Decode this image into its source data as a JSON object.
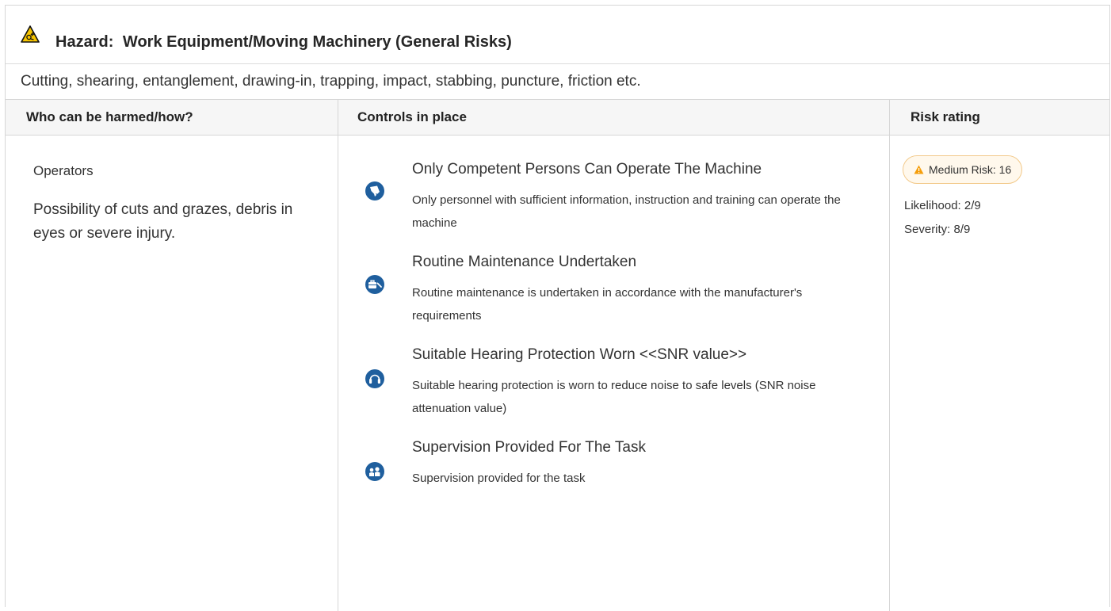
{
  "hazard": {
    "label": "Hazard:",
    "title": "Work Equipment/Moving Machinery (General Risks)",
    "icon": "machinery-hazard-icon",
    "description": "Cutting, shearing, entanglement, drawing-in, trapping, impact, stabbing, puncture, friction etc."
  },
  "columns": [
    "Who can be harmed/how?",
    "Controls in place",
    "Risk rating"
  ],
  "who": {
    "title": "Operators",
    "description": "Possibility of cuts and grazes, debris in eyes or severe injury."
  },
  "controls": [
    {
      "icon": "certificate-icon",
      "title": "Only Competent Persons Can Operate The Machine",
      "description": "Only personnel with sufficient information, instruction and training can operate the machine"
    },
    {
      "icon": "toolbox-icon",
      "title": "Routine Maintenance Undertaken",
      "description": "Routine maintenance is undertaken in accordance with the manufacturer's requirements"
    },
    {
      "icon": "ear-protection-icon",
      "title": "Suitable Hearing Protection Worn <<SNR value>>",
      "description": "Suitable hearing protection is worn to reduce noise to safe levels (SNR noise attenuation value)"
    },
    {
      "icon": "supervision-icon",
      "title": "Supervision Provided For The Task",
      "description": "Supervision provided for the task"
    }
  ],
  "risk": {
    "badge": "Medium Risk: 16",
    "likelihood": "Likelihood: 2/9",
    "severity": "Severity: 8/9",
    "colors": {
      "badge_border": "#f2c98a",
      "badge_bg": "#fff8ec",
      "warning": "#f59e0b"
    }
  },
  "colors": {
    "icon_blue": "#1f5f9e",
    "hazard_yellow": "#f6c400"
  }
}
